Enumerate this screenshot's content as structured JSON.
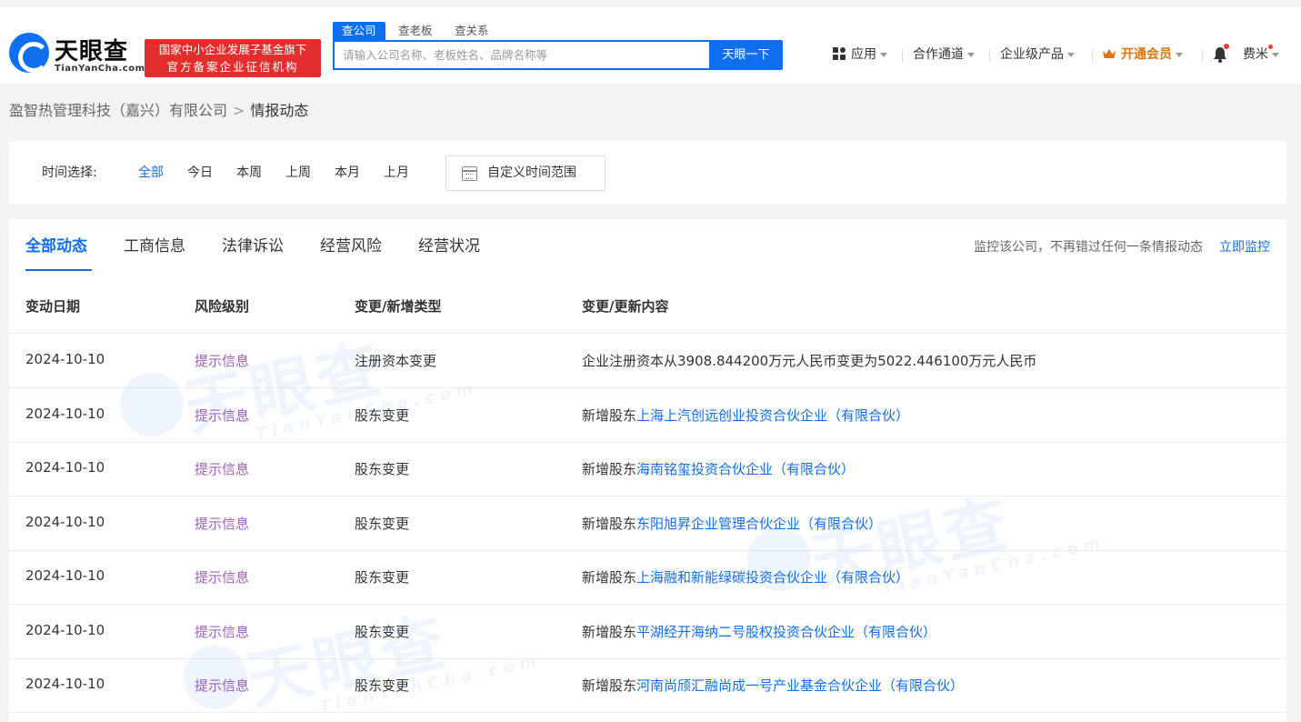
{
  "header": {
    "logo_text": "天眼查",
    "logo_sub": "TianYanCha.com",
    "badge_line1": "国家中小企业发展子基金旗下",
    "badge_line2": "官方备案企业征信机构",
    "search_tabs": [
      "查公司",
      "查老板",
      "查关系"
    ],
    "search_placeholder": "请输入公司名称、老板姓名、品牌名称等",
    "search_button": "天眼一下",
    "nav_apps": "应用",
    "nav_partner": "合作通道",
    "nav_enterprise": "企业级产品",
    "nav_vip": "开通会员",
    "nav_user": "费米"
  },
  "breadcrumb": {
    "company": "盈智热管理科技（嘉兴）有限公司",
    "separator": ">",
    "current": "情报动态"
  },
  "filter": {
    "label": "时间选择:",
    "options": [
      "全部",
      "今日",
      "本周",
      "上周",
      "本月",
      "上月"
    ],
    "selected": "全部",
    "custom_range": "自定义时间范围"
  },
  "tabs": [
    "全部动态",
    "工商信息",
    "法律诉讼",
    "经营风险",
    "经营状况"
  ],
  "monitor": {
    "text": "监控该公司，不再错过任何一条情报动态",
    "link": "立即监控"
  },
  "table": {
    "headers": [
      "变动日期",
      "风险级别",
      "变更/新增类型",
      "变更/更新内容"
    ],
    "rows": [
      {
        "date": "2024-10-10",
        "risk": "提示信息",
        "type": "注册资本变更",
        "prefix": "企业注册资本从3908.844200万元人民币变更为5022.446100万元人民币",
        "link": ""
      },
      {
        "date": "2024-10-10",
        "risk": "提示信息",
        "type": "股东变更",
        "prefix": "新增股东",
        "link": "上海上汽创远创业投资合伙企业（有限合伙）"
      },
      {
        "date": "2024-10-10",
        "risk": "提示信息",
        "type": "股东变更",
        "prefix": "新增股东",
        "link": "海南铭玺投资合伙企业（有限合伙）"
      },
      {
        "date": "2024-10-10",
        "risk": "提示信息",
        "type": "股东变更",
        "prefix": "新增股东",
        "link": "东阳旭昇企业管理合伙企业（有限合伙）"
      },
      {
        "date": "2024-10-10",
        "risk": "提示信息",
        "type": "股东变更",
        "prefix": "新增股东",
        "link": "上海融和新能绿碳投资合伙企业（有限合伙）"
      },
      {
        "date": "2024-10-10",
        "risk": "提示信息",
        "type": "股东变更",
        "prefix": "新增股东",
        "link": "平湖经开海纳二号股权投资合伙企业（有限合伙）"
      },
      {
        "date": "2024-10-10",
        "risk": "提示信息",
        "type": "股东变更",
        "prefix": "新增股东",
        "link": "河南尚颀汇融尚成一号产业基金合伙企业（有限合伙）"
      }
    ]
  },
  "watermark": {
    "text": "天眼查",
    "sub": "TianYanCha.com"
  },
  "colors": {
    "accent": "#0f6ff0",
    "risk": "#a25fc0",
    "badge": "#e42d2d",
    "vip": "#e0750b"
  }
}
